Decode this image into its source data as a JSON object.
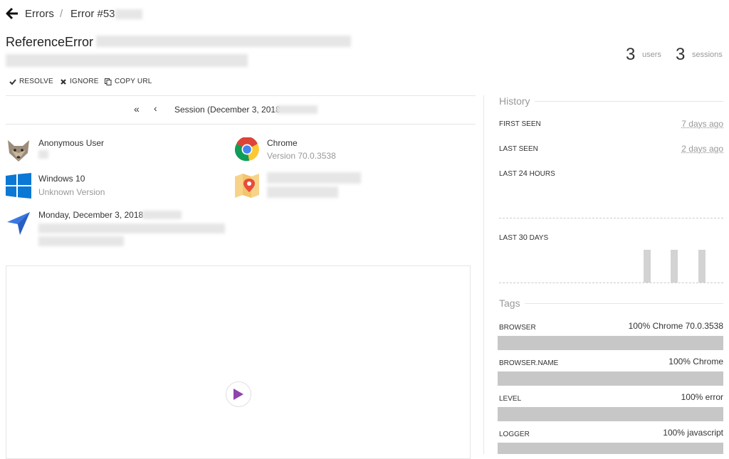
{
  "breadcrumb": {
    "errors": "Errors",
    "separator": "/",
    "error": "Error #53"
  },
  "error": {
    "title": "ReferenceError"
  },
  "stats": {
    "users_count": "3",
    "users_label": "users",
    "sessions_count": "3",
    "sessions_label": "sessions"
  },
  "actions": {
    "resolve": "RESOLVE",
    "ignore": "IGNORE",
    "copy_url": "COPY URL"
  },
  "session": {
    "nav_first": "«",
    "nav_prev": "‹",
    "title": "Session (December 3, 2018",
    "user": "Anonymous User",
    "browser": "Chrome",
    "browser_version": "Version 70.0.3538",
    "os": "Windows 10",
    "os_version": "Unknown Version",
    "date": "Monday, December 3, 2018"
  },
  "history": {
    "heading": "History",
    "first_seen_label": "FIRST SEEN",
    "first_seen_value": "7 days ago",
    "last_seen_label": "LAST SEEN",
    "last_seen_value": "2 days ago",
    "last24_prefix": "LAST",
    "last24_num": "24",
    "last24_suffix": "HOURS",
    "last30_prefix": "LAST",
    "last30_num": "30",
    "last30_suffix": "DAYS"
  },
  "tags": {
    "heading": "Tags",
    "items": [
      {
        "key": "BROWSER",
        "value": "100%  Chrome 70.0.3538",
        "fraction": 1.0
      },
      {
        "key": "BROWSER.NAME",
        "value": "100%  Chrome",
        "fraction": 1.0
      },
      {
        "key": "LEVEL",
        "value": "100%  error",
        "fraction": 1.0
      },
      {
        "key": "LOGGER",
        "value": "100%  javascript",
        "fraction": 1.0
      }
    ]
  },
  "icons": {
    "back": "arrow-left-icon",
    "check": "check-icon",
    "x": "x-icon",
    "copy": "copy-icon",
    "user": "fox-avatar-icon",
    "chrome": "chrome-icon",
    "windows": "windows-icon",
    "map": "map-pin-icon",
    "location": "navigation-arrow-icon",
    "play": "play-icon"
  },
  "colors": {
    "accent": "#8e44ad",
    "windows": "#0a78d4",
    "nav_arrow": "#3a78e0",
    "bar": "#c7c7c7"
  }
}
